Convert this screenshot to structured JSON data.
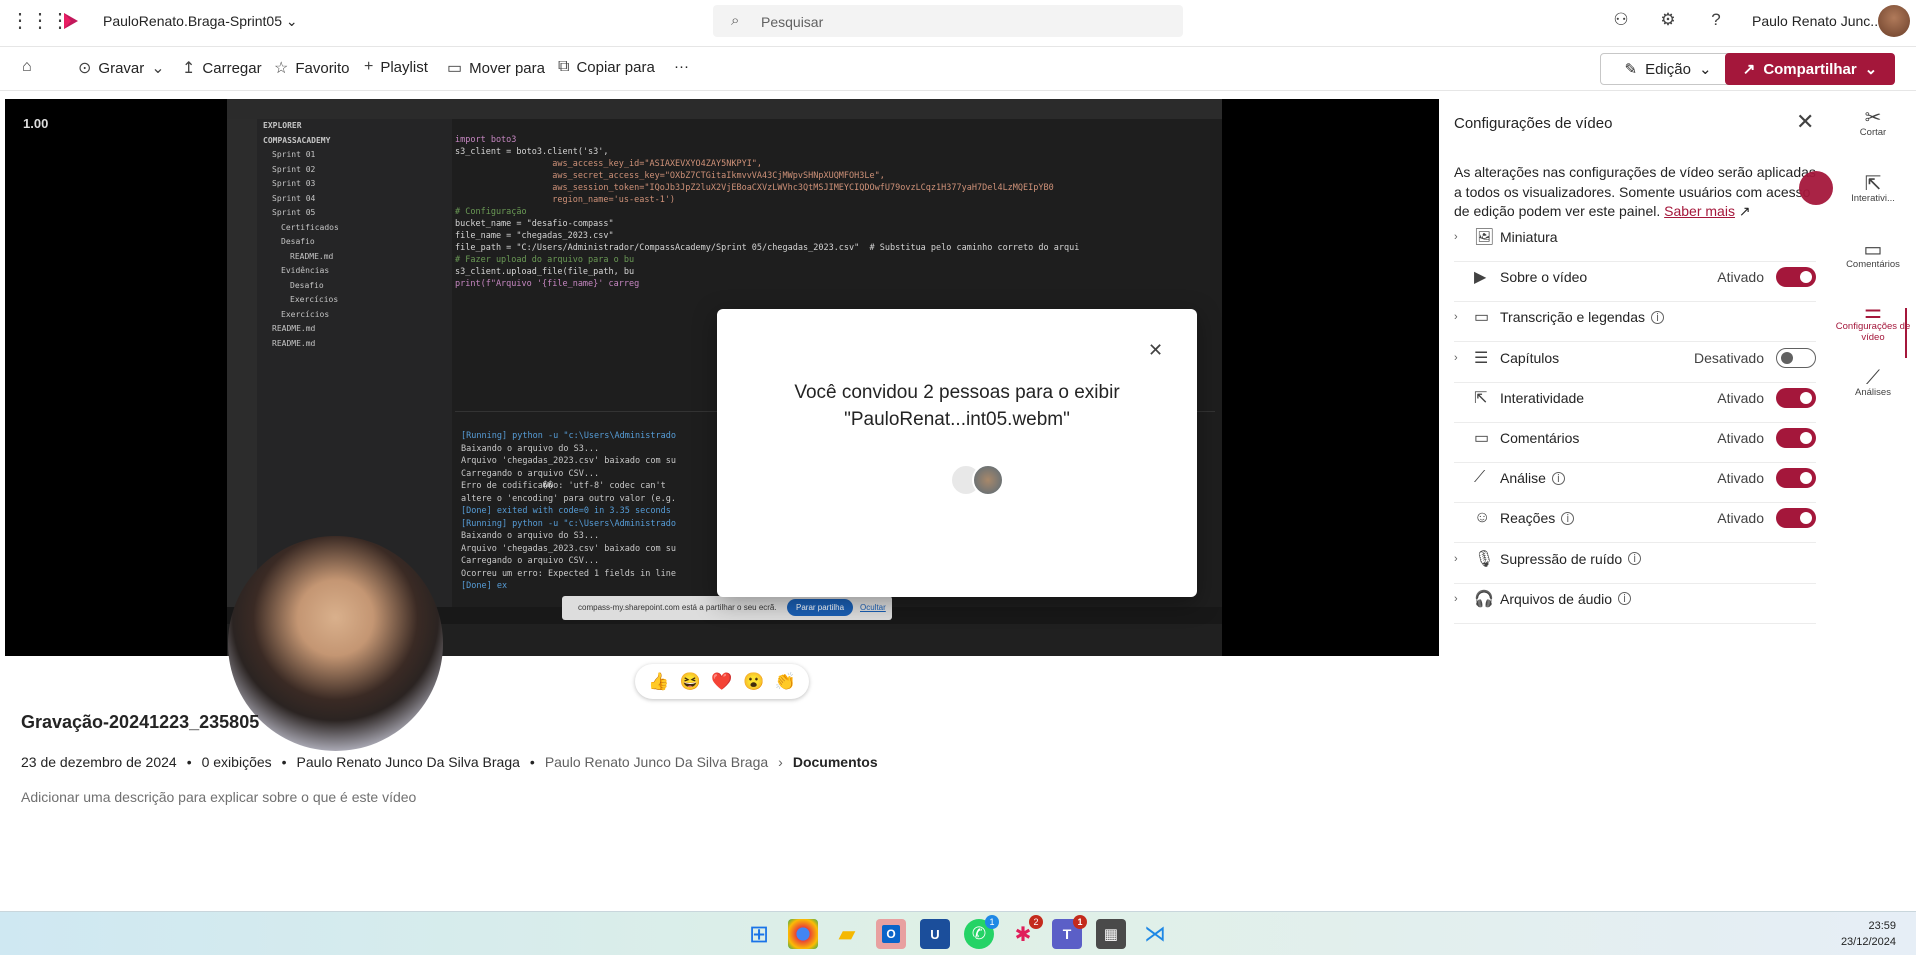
{
  "app": {
    "title": "PauloRenato.Braga-Sprint05",
    "search_placeholder": "Pesquisar",
    "user_name": "Paulo Renato Junc..."
  },
  "toolbar": {
    "record": "Gravar",
    "upload": "Carregar",
    "favorite": "Favorito",
    "playlist": "Playlist",
    "move": "Mover para",
    "copy": "Copiar para",
    "more": "···",
    "edit": "Edição",
    "share": "Compartilhar"
  },
  "video": {
    "speed": "1.00",
    "title": "Gravação-20241223_235805",
    "date": "23 de dezembro de 2024",
    "views": "0 exibições",
    "author": "Paulo Renato Junco Da Silva Braga",
    "path_owner": "Paulo Renato Junco Da Silva Braga",
    "path_folder": "Documentos",
    "description_placeholder": "Adicionar uma descrição para explicar sobre o que é este vídeo"
  },
  "vscode": {
    "explorer": [
      "EXPLORER",
      "COMPASSACADEMY",
      "Sprint 01",
      "Sprint 02",
      "Sprint 03",
      "Sprint 04",
      "Sprint 05",
      "Certificados",
      "Desafio",
      "README.md",
      "Evidências",
      "Desafio",
      "Exercícios",
      "Exercícios",
      "README.md",
      "README.md"
    ],
    "code": [
      "import boto3",
      "",
      "s3_client = boto3.client('s3',",
      "                   aws_access_key_id=\"ASIAXEVXYO4ZAY5NKPYI\",",
      "                   aws_secret_access_key=\"OXbZ7CTGitaIkmvvVA43CjMWpvSHNpXUQMFOH3Le\",",
      "                   aws_session_token=\"IQoJb3JpZ2luX2VjEBoaCXVzLWVhc3QtMSJIMEYCIQDOwfU79ovzLCqz1H377yaH7Del4LzMQEIpYB0",
      "                   region_name='us-east-1')",
      "",
      "# Configuração",
      "bucket_name = \"desafio-compass\"",
      "file_name = \"chegadas_2023.csv\"",
      "file_path = \"C:/Users/Administrador/CompassAcademy/Sprint 05/chegadas_2023.csv\"  # Substitua pelo caminho correto do arqui",
      "",
      "# Fazer upload do arquivo para o bu",
      "s3_client.upload_file(file_path, bu",
      "print(f\"Arquivo '{file_name}' carreg"
    ],
    "output": [
      "[Running] python -u \"c:\\Users\\Administrado",
      "Baixando o arquivo do S3...",
      "Arquivo 'chegadas_2023.csv' baixado com su",
      "Carregando o arquivo CSV...",
      "Erro de codifica��o: 'utf-8' codec can't",
      "altere o 'encoding' para outro valor (e.g.",
      "",
      "[Done] exited with code=0 in 3.35 seconds",
      "",
      "[Running] python -u \"c:\\Users\\Administrado",
      "Baixando o arquivo do S3...",
      "Arquivo 'chegadas_2023.csv' baixado com su",
      "Carregando o arquivo CSV...",
      "Ocorreu um erro: Expected 1 fields in line",
      "",
      "[Done] ex"
    ],
    "notification": "compass-my.sharepoint.com está a partilhar o seu ecrã.",
    "stop_sharing": "Parar partilha",
    "hide": "Ocultar"
  },
  "modal": {
    "line1": "Você convidou 2 pessoas para o exibir",
    "line2": "\"PauloRenat...int05.webm\""
  },
  "panel": {
    "title": "Configurações de vídeo",
    "note": "As alterações nas configurações de vídeo serão aplicadas a todos os visualizadores. Somente usuários com acesso de edição podem ver este painel.",
    "learn_more": "Saber mais",
    "rows": [
      {
        "label": "Miniatura",
        "status": ""
      },
      {
        "label": "Sobre o vídeo",
        "status": "Ativado"
      },
      {
        "label": "Transcrição e legendas",
        "status": ""
      },
      {
        "label": "Capítulos",
        "status": "Desativado"
      },
      {
        "label": "Interatividade",
        "status": "Ativado"
      },
      {
        "label": "Comentários",
        "status": "Ativado"
      },
      {
        "label": "Análise",
        "status": "Ativado"
      },
      {
        "label": "Reações",
        "status": "Ativado"
      },
      {
        "label": "Supressão de ruído",
        "status": ""
      },
      {
        "label": "Arquivos de áudio",
        "status": ""
      }
    ]
  },
  "rail": {
    "cut": "Cortar",
    "interactivity": "Interativi...",
    "comments": "Comentários",
    "settings": "Configurações de vídeo",
    "analytics": "Análises"
  },
  "taskbar": {
    "time": "23:59",
    "date": "23/12/2024",
    "badges": [
      "1",
      "2",
      "1"
    ]
  },
  "colors": {
    "accent": "#a4173b"
  }
}
